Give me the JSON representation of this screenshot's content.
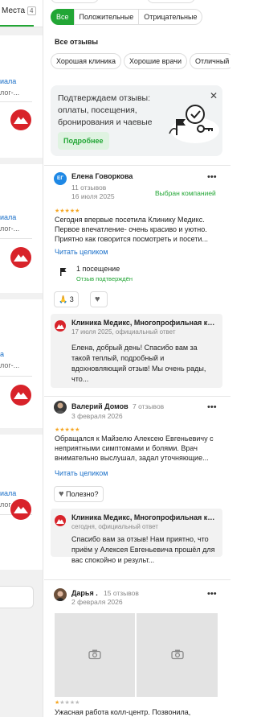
{
  "left": {
    "tab_label": "Места",
    "tab_count": "4",
    "cards": [
      {
        "link": "иала",
        "sub": "лог-..."
      },
      {
        "link": "иала",
        "sub": "лог-..."
      },
      {
        "link": "а",
        "sub": "лог-..."
      },
      {
        "link": "иала",
        "sub": "лог-..."
      }
    ]
  },
  "filters": {
    "items": [
      "Все",
      "Положительные",
      "Отрицательные"
    ],
    "selected": "Все"
  },
  "all_reviews_title": "Все отзывы",
  "tags": [
    "Хорошая клиника",
    "Хорошие врачи",
    "Отличный"
  ],
  "promo": {
    "text": "Подтверждаем отзывы: оплаты, посещения, бронирования и чаевые",
    "button": "Подробнее"
  },
  "reviews": [
    {
      "initials": "ЕГ",
      "avatar_color": "#1e88e5",
      "name": "Елена Говоркова",
      "count": "11 отзывов",
      "date": "16 июля 2025",
      "badge": "Выбран компанией",
      "rating": 5,
      "text": "Сегодня впервые посетила Клинику Медикс. Первое впечатление- очень красиво и уютно. Приятно как говорится посмотреть и посети...",
      "read_more": "Читать целиком",
      "visit_label": "1 посещение",
      "visit_sub": "Отзыв подтверждён",
      "reaction_count": "3",
      "reply": {
        "company": "Клиника Медикс, Многопрофильная клиника",
        "meta": "17 июля 2025, официальный ответ",
        "text": "Елена, добрый день! Спасибо вам за такой теплый, подробный и вдохновляющий отзыв! Мы очень рады, что..."
      }
    },
    {
      "name": "Валерий Домов",
      "count": "7 отзывов",
      "date": "3 февраля 2026",
      "rating": 5,
      "text": "Обращался к Майзелю Алексею Евгеньевичу с неприятными симптомами и болями. Врач внимательно выслушал, задал уточняющие...",
      "read_more": "Читать целиком",
      "useful": "Полезно?",
      "reply": {
        "company": "Клиника Медикс, Многопрофильная клиника",
        "meta": "сегодня, официальный ответ",
        "text": "Спасибо вам за отзыв! Нам приятно, что приём у Алексея Евгеньевича прошёл для вас спокойно и результ..."
      }
    },
    {
      "name": "Дарья .",
      "count": "15 отзывов",
      "date": "2 февраля 2026",
      "rating": 1,
      "text": "Ужасная работа колл-центр. Позвонила,"
    }
  ]
}
